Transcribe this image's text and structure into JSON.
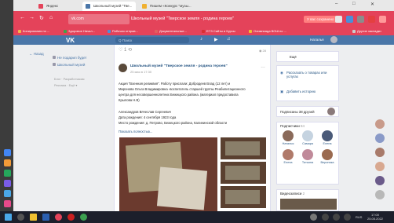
{
  "browser": {
    "tabs": [
      {
        "label": "Яндекс"
      },
      {
        "label": "Школьный музей \"Тве..."
      },
      {
        "label": "Пишем «Конкурс \"музы..."
      }
    ]
  },
  "address_bar": {
    "url": "vk.com",
    "page_title": "Школьный музей \"Тверское земля - родина героев\"",
    "badge": "У вас сохранено"
  },
  "bookmarks": [
    {
      "label": "Копирования по ...",
      "color": "#f2b84b"
    },
    {
      "label": "Здоровое Начал...",
      "color": "#44a04a"
    },
    {
      "label": "Рабочая отправ...",
      "color": "#4a90d9"
    },
    {
      "label": "Документальные...",
      "color": "#e06060"
    },
    {
      "label": "ЕГЭ Сайты и Курсы",
      "color": "#d93030"
    },
    {
      "label": "Олимпиада ВОШ по ...",
      "color": "#f0c030"
    },
    {
      "label": "Другие закладки",
      "color": "#cccccc"
    }
  ],
  "vk": {
    "logo": "VK",
    "search_placeholder": "Q Поиск",
    "user": "Наталья"
  },
  "left": {
    "back": "← Назад",
    "links": [
      "Не подарил будет",
      "Школьный музей"
    ],
    "footer": [
      "Блог · Разработчикам",
      "Реклама · Ещё ▾"
    ]
  },
  "post": {
    "actions": "♡ 1   ⟲",
    "views": "◉ 28",
    "author": "Школьный музей \"Тверское земля - родина героев\"",
    "date": "25 мая в 17:30",
    "lines": [
      "Акция \"Военная реликвия\". Работу прислали: Добродеев Влад (12 лет) и",
      "Миронова Ольга Владимировна -воспитатель старшей группы Реабилитационного",
      "центра для несовершеннолетних Бежецкого района. (материал предоставила",
      "Крылова Н.В)",
      "",
      "Александров Вячеслав Сергеевич",
      "Дата рождения: 4 сентября 1923 года",
      "Место рождения: д. Петрово, Бежецкого района, Калининской области"
    ],
    "show_more": "Показать полностью..."
  },
  "right": {
    "more": "Ещё",
    "recommend": "Рассказать о товарах или услугах",
    "add_product": "Добавить историю",
    "followers": "Подписаны 38 друзей",
    "subs_title": "Подписчики",
    "subs_count": "84",
    "subscribers": [
      {
        "name": "Наталья",
        "color": "#8a6a5a"
      },
      {
        "name": "Самара",
        "color": "#c5d3e0"
      },
      {
        "name": "Елена",
        "color": "#4a5a78"
      },
      {
        "name": "Елена",
        "color": "#b07a6a"
      },
      {
        "name": "Татьяна",
        "color": "#c08a9a"
      },
      {
        "name": "Вероника",
        "color": "#9a6a50"
      }
    ],
    "videos_title": "Видеозаписи",
    "videos_count": "2"
  },
  "taskbar": {
    "lang": "RUS",
    "time": "17:00",
    "date": "25.05.2022"
  }
}
